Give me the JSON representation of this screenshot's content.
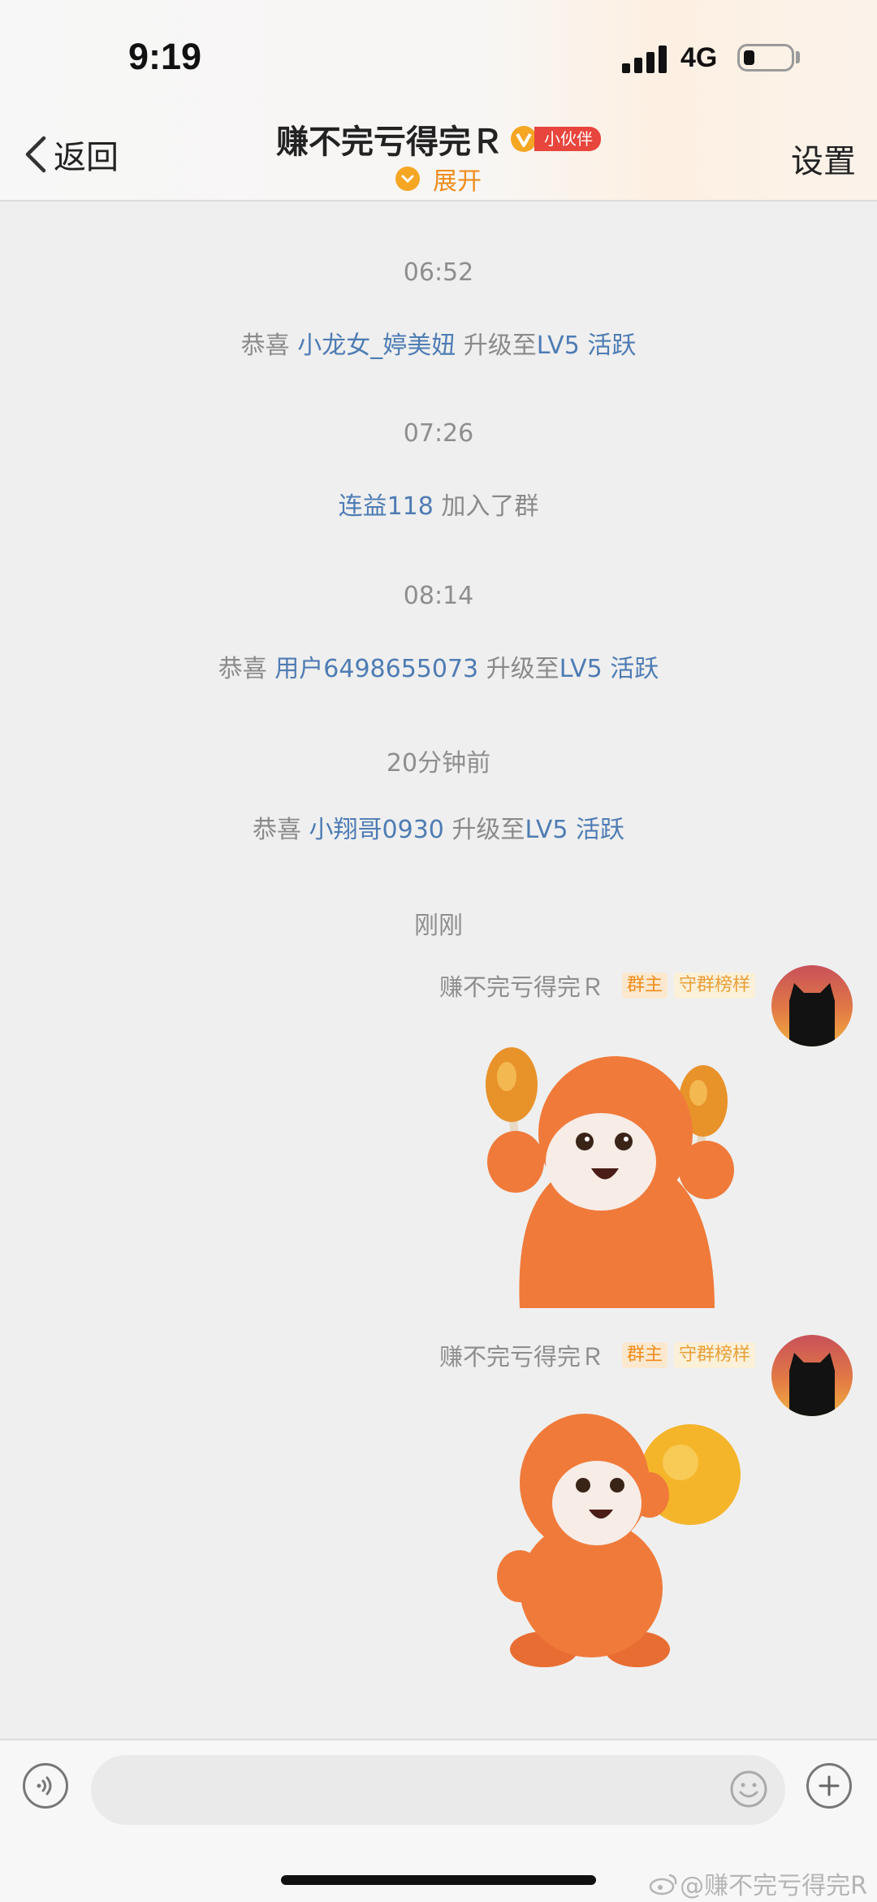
{
  "status_bar": {
    "time": "9:19",
    "network": "4G"
  },
  "header": {
    "back_label": "返回",
    "title": "赚不完亏得完Ｒ",
    "partner_badge": "小伙伴",
    "expand_label": "展开",
    "settings_label": "设置"
  },
  "messages": [
    {
      "time": "06:52",
      "prefix": "恭喜",
      "user": "小龙女_婷美妞",
      "action": "升级至",
      "level": "LV5 活跃"
    },
    {
      "time": "07:26",
      "user": "连益118",
      "action": "加入了群"
    },
    {
      "time": "08:14",
      "prefix": "恭喜",
      "user": "用户6498655073",
      "action": "升级至",
      "level": "LV5 活跃"
    },
    {
      "time": "20分钟前",
      "prefix": "恭喜",
      "user": "小翔哥0930",
      "action": "升级至",
      "level": "LV5 活跃"
    }
  ],
  "latest": {
    "time": "刚刚",
    "sender": "赚不完亏得完Ｒ",
    "tag_owner": "群主",
    "tag_rank": "守群榜样"
  },
  "input": {
    "placeholder": ""
  },
  "watermark": "@赚不完亏得完R",
  "colors": {
    "link": "#4e7cb4",
    "accent": "#f08c1b",
    "badge_red": "#e8453c",
    "sticker_orange": "#f07a3a"
  }
}
